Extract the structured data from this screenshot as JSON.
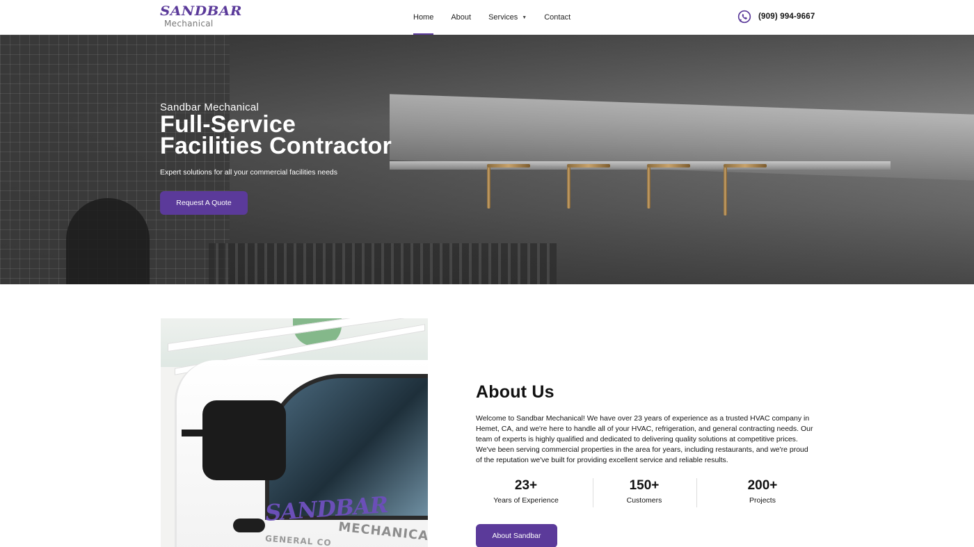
{
  "header": {
    "logo": {
      "main": "SANDBAR",
      "sub": "Mechanical"
    },
    "nav": [
      {
        "label": "Home",
        "active": true
      },
      {
        "label": "About",
        "active": false
      },
      {
        "label": "Services",
        "active": false,
        "has_dropdown": true
      },
      {
        "label": "Contact",
        "active": false
      }
    ],
    "phone": "(909) 994-9667"
  },
  "hero": {
    "kicker": "Sandbar Mechanical",
    "title": "Full-Service Facilities Contractor",
    "tagline": "Expert solutions for all your commercial facilities needs",
    "cta_label": "Request A Quote"
  },
  "about": {
    "truck_logo": "SANDBAR",
    "truck_text": "MECHANICAL",
    "truck_text2": "GENERAL CO",
    "title": "About Us",
    "body": "Welcome to Sandbar Mechanical! We have over 23 years of experience as a trusted HVAC company in Hemet, CA, and we're here to handle all of your HVAC, refrigeration, and general contracting needs. Our team of experts is highly qualified and dedicated to delivering quality solutions at competitive prices. We've been serving commercial properties in the area for years, including restaurants, and we're proud of the reputation we've built for providing excellent service and reliable results.",
    "stats": [
      {
        "value": "23+",
        "label": "Years of Experience"
      },
      {
        "value": "150+",
        "label": "Customers"
      },
      {
        "value": "200+",
        "label": "Projects"
      }
    ],
    "cta_label": "About Sandbar"
  },
  "colors": {
    "accent": "#5b3a9a",
    "text": "#111111"
  },
  "icons": {
    "phone": "whatsapp-phone-icon",
    "dropdown": "chevron-down-icon"
  }
}
